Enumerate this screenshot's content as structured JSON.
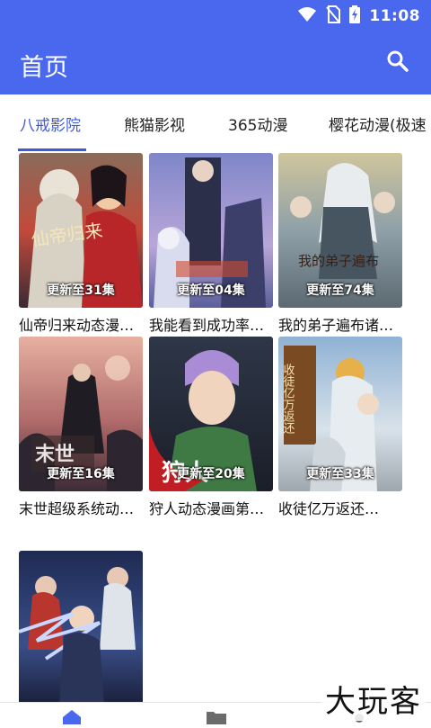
{
  "status_bar": {
    "time": "11:08",
    "icons": [
      "wifi-icon",
      "no-sim-icon",
      "battery-charging-icon"
    ]
  },
  "app_bar": {
    "title": "首页",
    "search_icon": "search-icon"
  },
  "tabs": [
    {
      "label": "八戒影院",
      "active": true
    },
    {
      "label": "熊猫影视",
      "active": false
    },
    {
      "label": "365动漫",
      "active": false
    },
    {
      "label": "樱花动漫(极速",
      "active": false
    }
  ],
  "cards": [
    {
      "title": "仙帝归来动态漫画…",
      "badge": "更新至31集",
      "art_text": "仙帝归来"
    },
    {
      "title": "我能看到成功率…",
      "badge": "更新至04集",
      "art_text": ""
    },
    {
      "title": "我的弟子遍布诸天…",
      "badge": "更新至74集",
      "art_text": "我的弟子遍布"
    },
    {
      "title": "末世超级系统动态…",
      "badge": "更新至16集",
      "art_text": "末世"
    },
    {
      "title": "狩人动态漫画第一…",
      "badge": "更新至20集",
      "art_text": "狩人"
    },
    {
      "title": "收徒亿万返还…",
      "badge": "更新至33集",
      "art_text": "收徒亿万返还"
    },
    {
      "title": "",
      "badge": "",
      "art_text": ""
    }
  ],
  "bottom_nav": [
    {
      "icon": "home-icon",
      "active": true
    },
    {
      "icon": "folder-icon",
      "active": false
    },
    {
      "icon": "dot-icon",
      "active": false
    }
  ],
  "watermark": "大玩客",
  "colors": {
    "primary": "#4a68ee",
    "tab_active": "#3f5bd6"
  }
}
